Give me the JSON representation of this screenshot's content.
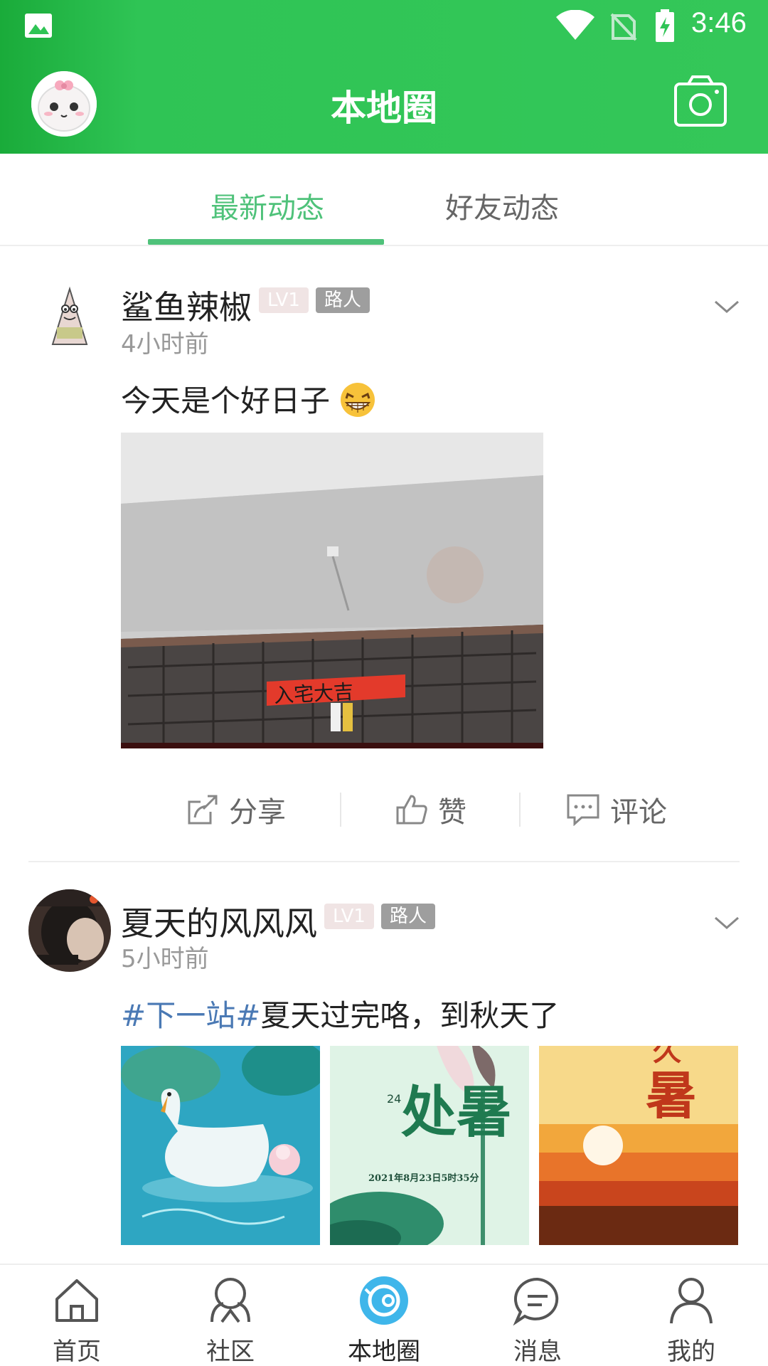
{
  "status_bar": {
    "time": "3:46"
  },
  "header": {
    "title": "本地圈",
    "camera_icon": "camera-icon"
  },
  "tabs": [
    {
      "label": "最新动态",
      "active": true
    },
    {
      "label": "好友动态",
      "active": false
    }
  ],
  "posts": [
    {
      "author": "鲨鱼辣椒",
      "level": "LV1",
      "role": "路人",
      "time": "4小时前",
      "text": "今天是个好日子",
      "emoji": "grinning-emoji",
      "image_text": "入宅大吉",
      "actions": {
        "share": "分享",
        "like": "赞",
        "comment": "评论"
      }
    },
    {
      "author": "夏天的风风风",
      "level": "LV1",
      "role": "路人",
      "time": "5小时前",
      "topic": "#下一站#",
      "text": "夏天过完咯，到秋天了",
      "images": [
        {
          "caption": ""
        },
        {
          "title": "处暑",
          "date": "2021年8月23日5时35分"
        },
        {
          "title": "暑"
        }
      ]
    }
  ],
  "bottom_nav": [
    {
      "label": "首页",
      "icon": "home-icon"
    },
    {
      "label": "社区",
      "icon": "community-icon"
    },
    {
      "label": "本地圈",
      "icon": "local-circle-icon",
      "active": true
    },
    {
      "label": "消息",
      "icon": "message-icon"
    },
    {
      "label": "我的",
      "icon": "profile-icon"
    }
  ],
  "colors": {
    "header_green": "#34c759",
    "accent_green": "#4fc27a",
    "topic_blue": "#4a79b4",
    "nav_active": "#3fb6ea"
  }
}
